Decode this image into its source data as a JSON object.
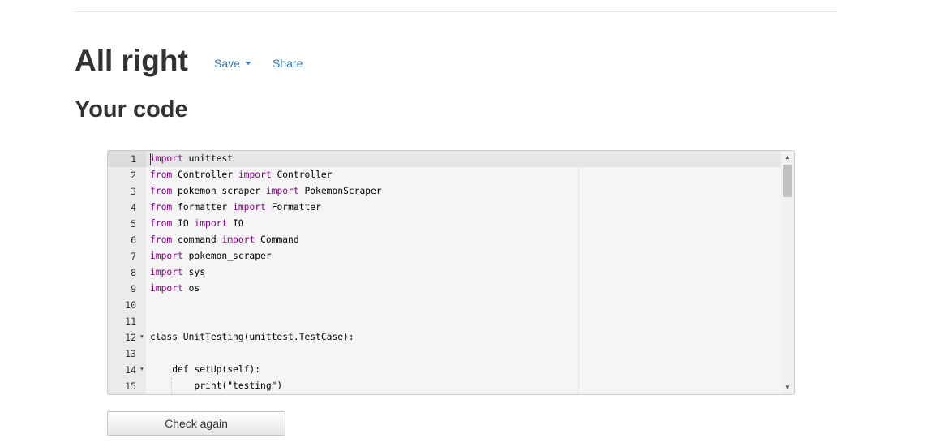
{
  "header": {
    "title": "All right",
    "save_label": "Save",
    "share_label": "Share"
  },
  "section": {
    "title": "Your code"
  },
  "editor": {
    "lines": [
      {
        "num": "1",
        "code": "import unittest"
      },
      {
        "num": "2",
        "code": "from Controller import Controller"
      },
      {
        "num": "3",
        "code": "from pokemon_scraper import PokemonScraper"
      },
      {
        "num": "4",
        "code": "from formatter import Formatter"
      },
      {
        "num": "5",
        "code": "from IO import IO"
      },
      {
        "num": "6",
        "code": "from command import Command"
      },
      {
        "num": "7",
        "code": "import pokemon_scraper"
      },
      {
        "num": "8",
        "code": "import sys"
      },
      {
        "num": "9",
        "code": "import os"
      },
      {
        "num": "10",
        "code": ""
      },
      {
        "num": "11",
        "code": ""
      },
      {
        "num": "12",
        "code": "class UnitTesting(unittest.TestCase):"
      },
      {
        "num": "13",
        "code": ""
      },
      {
        "num": "14",
        "code": "    def setUp(self):"
      },
      {
        "num": "15",
        "code": "        print(\"testing\")"
      }
    ],
    "keyword_color": "#800080",
    "active_line": 1
  },
  "footer": {
    "check_label": "Check again"
  },
  "colors": {
    "link": "#337ab7",
    "text": "#333333"
  }
}
